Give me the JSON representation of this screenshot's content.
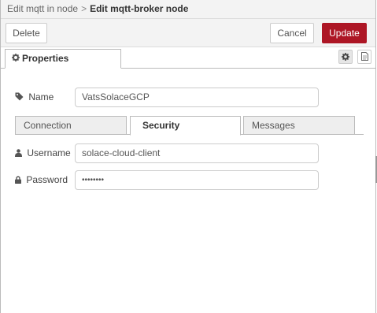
{
  "breadcrumb": {
    "parent": "Edit mqtt in node",
    "separator": ">",
    "current": "Edit mqtt-broker node"
  },
  "toolbar": {
    "delete_label": "Delete",
    "cancel_label": "Cancel",
    "update_label": "Update"
  },
  "tabs": {
    "properties_label": "Properties",
    "settings_icon": "gear-icon",
    "description_icon": "file-text-icon"
  },
  "form": {
    "name_label": "Name",
    "name_value": "VatsSolaceGCP",
    "username_label": "Username",
    "username_value": "solace-cloud-client",
    "password_label": "Password",
    "password_value": "••••••••"
  },
  "subtabs": [
    {
      "label": "Connection",
      "active": false
    },
    {
      "label": "Security",
      "active": true
    },
    {
      "label": "Messages",
      "active": false
    }
  ],
  "colors": {
    "primary": "#ad1625",
    "header_bg": "#f3f3f3",
    "border": "#bbbbbb"
  }
}
